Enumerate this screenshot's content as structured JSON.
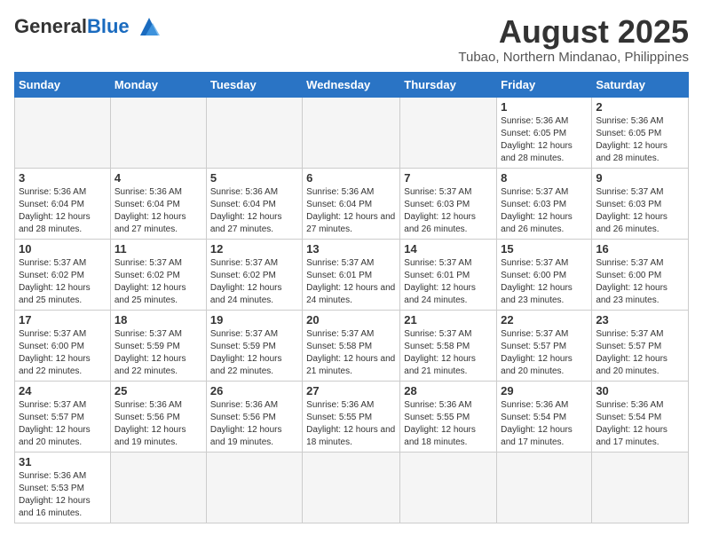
{
  "header": {
    "logo_general": "General",
    "logo_blue": "Blue",
    "month_title": "August 2025",
    "location": "Tubao, Northern Mindanao, Philippines"
  },
  "weekdays": [
    "Sunday",
    "Monday",
    "Tuesday",
    "Wednesday",
    "Thursday",
    "Friday",
    "Saturday"
  ],
  "weeks": [
    [
      {
        "day": "",
        "info": ""
      },
      {
        "day": "",
        "info": ""
      },
      {
        "day": "",
        "info": ""
      },
      {
        "day": "",
        "info": ""
      },
      {
        "day": "",
        "info": ""
      },
      {
        "day": "1",
        "info": "Sunrise: 5:36 AM\nSunset: 6:05 PM\nDaylight: 12 hours and 28 minutes."
      },
      {
        "day": "2",
        "info": "Sunrise: 5:36 AM\nSunset: 6:05 PM\nDaylight: 12 hours and 28 minutes."
      }
    ],
    [
      {
        "day": "3",
        "info": "Sunrise: 5:36 AM\nSunset: 6:04 PM\nDaylight: 12 hours and 28 minutes."
      },
      {
        "day": "4",
        "info": "Sunrise: 5:36 AM\nSunset: 6:04 PM\nDaylight: 12 hours and 27 minutes."
      },
      {
        "day": "5",
        "info": "Sunrise: 5:36 AM\nSunset: 6:04 PM\nDaylight: 12 hours and 27 minutes."
      },
      {
        "day": "6",
        "info": "Sunrise: 5:36 AM\nSunset: 6:04 PM\nDaylight: 12 hours and 27 minutes."
      },
      {
        "day": "7",
        "info": "Sunrise: 5:37 AM\nSunset: 6:03 PM\nDaylight: 12 hours and 26 minutes."
      },
      {
        "day": "8",
        "info": "Sunrise: 5:37 AM\nSunset: 6:03 PM\nDaylight: 12 hours and 26 minutes."
      },
      {
        "day": "9",
        "info": "Sunrise: 5:37 AM\nSunset: 6:03 PM\nDaylight: 12 hours and 26 minutes."
      }
    ],
    [
      {
        "day": "10",
        "info": "Sunrise: 5:37 AM\nSunset: 6:02 PM\nDaylight: 12 hours and 25 minutes."
      },
      {
        "day": "11",
        "info": "Sunrise: 5:37 AM\nSunset: 6:02 PM\nDaylight: 12 hours and 25 minutes."
      },
      {
        "day": "12",
        "info": "Sunrise: 5:37 AM\nSunset: 6:02 PM\nDaylight: 12 hours and 24 minutes."
      },
      {
        "day": "13",
        "info": "Sunrise: 5:37 AM\nSunset: 6:01 PM\nDaylight: 12 hours and 24 minutes."
      },
      {
        "day": "14",
        "info": "Sunrise: 5:37 AM\nSunset: 6:01 PM\nDaylight: 12 hours and 24 minutes."
      },
      {
        "day": "15",
        "info": "Sunrise: 5:37 AM\nSunset: 6:00 PM\nDaylight: 12 hours and 23 minutes."
      },
      {
        "day": "16",
        "info": "Sunrise: 5:37 AM\nSunset: 6:00 PM\nDaylight: 12 hours and 23 minutes."
      }
    ],
    [
      {
        "day": "17",
        "info": "Sunrise: 5:37 AM\nSunset: 6:00 PM\nDaylight: 12 hours and 22 minutes."
      },
      {
        "day": "18",
        "info": "Sunrise: 5:37 AM\nSunset: 5:59 PM\nDaylight: 12 hours and 22 minutes."
      },
      {
        "day": "19",
        "info": "Sunrise: 5:37 AM\nSunset: 5:59 PM\nDaylight: 12 hours and 22 minutes."
      },
      {
        "day": "20",
        "info": "Sunrise: 5:37 AM\nSunset: 5:58 PM\nDaylight: 12 hours and 21 minutes."
      },
      {
        "day": "21",
        "info": "Sunrise: 5:37 AM\nSunset: 5:58 PM\nDaylight: 12 hours and 21 minutes."
      },
      {
        "day": "22",
        "info": "Sunrise: 5:37 AM\nSunset: 5:57 PM\nDaylight: 12 hours and 20 minutes."
      },
      {
        "day": "23",
        "info": "Sunrise: 5:37 AM\nSunset: 5:57 PM\nDaylight: 12 hours and 20 minutes."
      }
    ],
    [
      {
        "day": "24",
        "info": "Sunrise: 5:37 AM\nSunset: 5:57 PM\nDaylight: 12 hours and 20 minutes."
      },
      {
        "day": "25",
        "info": "Sunrise: 5:36 AM\nSunset: 5:56 PM\nDaylight: 12 hours and 19 minutes."
      },
      {
        "day": "26",
        "info": "Sunrise: 5:36 AM\nSunset: 5:56 PM\nDaylight: 12 hours and 19 minutes."
      },
      {
        "day": "27",
        "info": "Sunrise: 5:36 AM\nSunset: 5:55 PM\nDaylight: 12 hours and 18 minutes."
      },
      {
        "day": "28",
        "info": "Sunrise: 5:36 AM\nSunset: 5:55 PM\nDaylight: 12 hours and 18 minutes."
      },
      {
        "day": "29",
        "info": "Sunrise: 5:36 AM\nSunset: 5:54 PM\nDaylight: 12 hours and 17 minutes."
      },
      {
        "day": "30",
        "info": "Sunrise: 5:36 AM\nSunset: 5:54 PM\nDaylight: 12 hours and 17 minutes."
      }
    ],
    [
      {
        "day": "31",
        "info": "Sunrise: 5:36 AM\nSunset: 5:53 PM\nDaylight: 12 hours and 16 minutes."
      },
      {
        "day": "",
        "info": ""
      },
      {
        "day": "",
        "info": ""
      },
      {
        "day": "",
        "info": ""
      },
      {
        "day": "",
        "info": ""
      },
      {
        "day": "",
        "info": ""
      },
      {
        "day": "",
        "info": ""
      }
    ]
  ]
}
